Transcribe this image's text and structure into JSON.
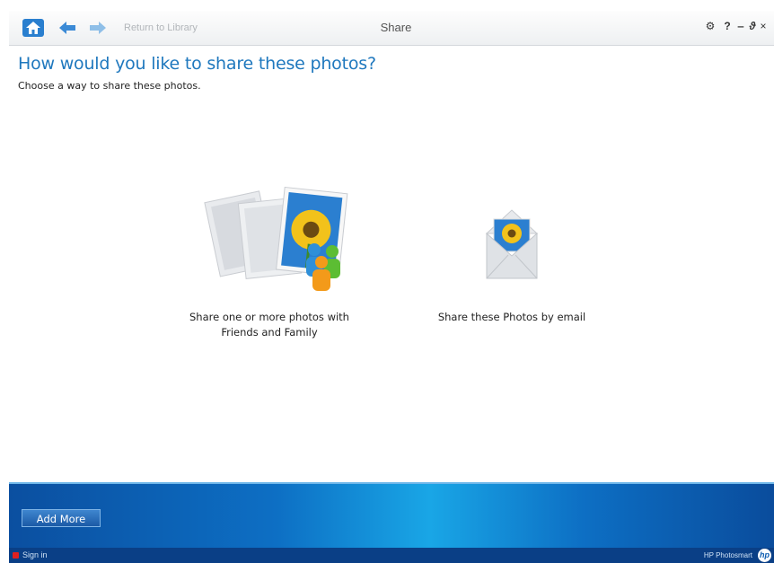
{
  "titlebar": {
    "return_label": "Return to Library",
    "title": "Share",
    "controls": {
      "settings": "⚙",
      "help": "?",
      "minimize": "‒",
      "maximize": "ϑ",
      "close": "×"
    }
  },
  "main": {
    "heading": "How would you like to share these photos?",
    "subheading": "Choose a way to share these photos.",
    "options": [
      {
        "label": "Share one or more photos with Friends and Family",
        "icon": "share-friends-icon"
      },
      {
        "label": "Share these Photos by email",
        "icon": "email-envelope-icon"
      }
    ]
  },
  "bottombar": {
    "add_more_label": "Add More"
  },
  "statusbar": {
    "sign_in_label": "Sign in",
    "brand": "HP Photosmart",
    "logo": "hp"
  },
  "colors": {
    "accent": "#1f78be",
    "bottom_bar": "#0d6fc4",
    "status_bar": "#0a3f86"
  }
}
